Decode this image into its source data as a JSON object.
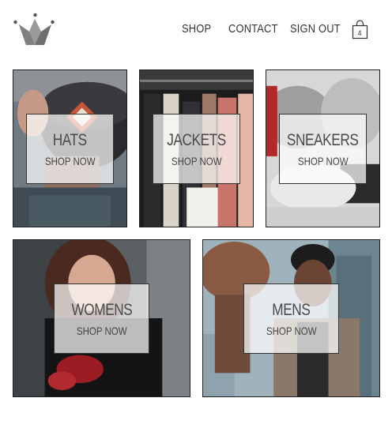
{
  "header": {
    "logo_icon": "crown-icon",
    "nav": {
      "shop": "SHOP",
      "contact": "CONTACT",
      "sign_out": "SIGN OUT"
    },
    "cart": {
      "icon": "shopping-bag-icon",
      "count": "4"
    }
  },
  "categories": [
    {
      "title": "HATS",
      "cta": "SHOP NOW"
    },
    {
      "title": "JACKETS",
      "cta": "SHOP NOW"
    },
    {
      "title": "SNEAKERS",
      "cta": "SHOP NOW"
    },
    {
      "title": "WOMENS",
      "cta": "SHOP NOW"
    },
    {
      "title": "MENS",
      "cta": "SHOP NOW"
    }
  ],
  "colors": {
    "text": "#333333",
    "border": "#222222",
    "crown": "#7a7a7a",
    "background": "#ffffff"
  }
}
